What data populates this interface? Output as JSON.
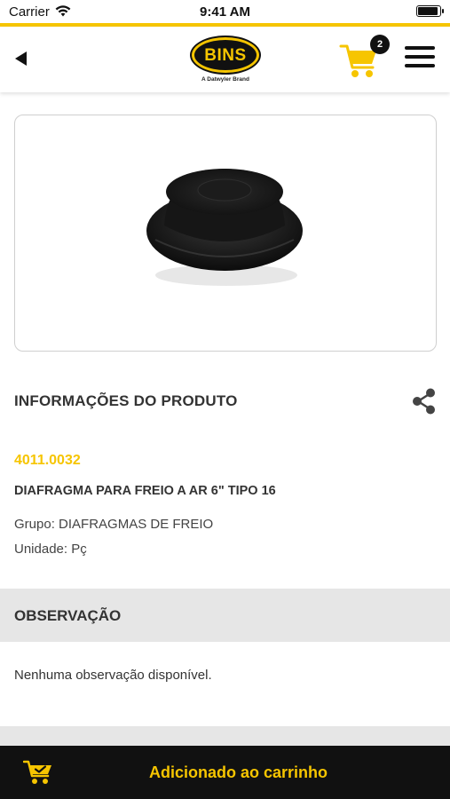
{
  "status_bar": {
    "carrier": "Carrier",
    "time": "9:41 AM",
    "battery_level": 0.95
  },
  "header": {
    "logo_text": "BINS",
    "logo_subtitle": "A Datwyler Brand",
    "cart_count": "2",
    "icons": {
      "back": "back-triangle-icon",
      "cart": "shopping-cart-icon",
      "menu": "hamburger-menu-icon"
    }
  },
  "colors": {
    "accent": "#f6c500",
    "dark": "#111111",
    "section_bg": "#e6e6e6"
  },
  "product": {
    "image_alt": "Diaphragm product photo",
    "section_title": "INFORMAÇÕES DO PRODUTO",
    "code": "4011.0032",
    "name": "DIAFRAGMA PARA FREIO A AR 6\" TIPO 16",
    "group": "Grupo: DIAFRAGMAS DE FREIO",
    "unit": "Unidade: Pç",
    "share_icon": "share-icon"
  },
  "observation": {
    "title": "OBSERVAÇÃO",
    "text": "Nenhuma observação disponível."
  },
  "toast": {
    "message": "Adicionado ao carrinho",
    "icon": "cart-check-icon"
  }
}
